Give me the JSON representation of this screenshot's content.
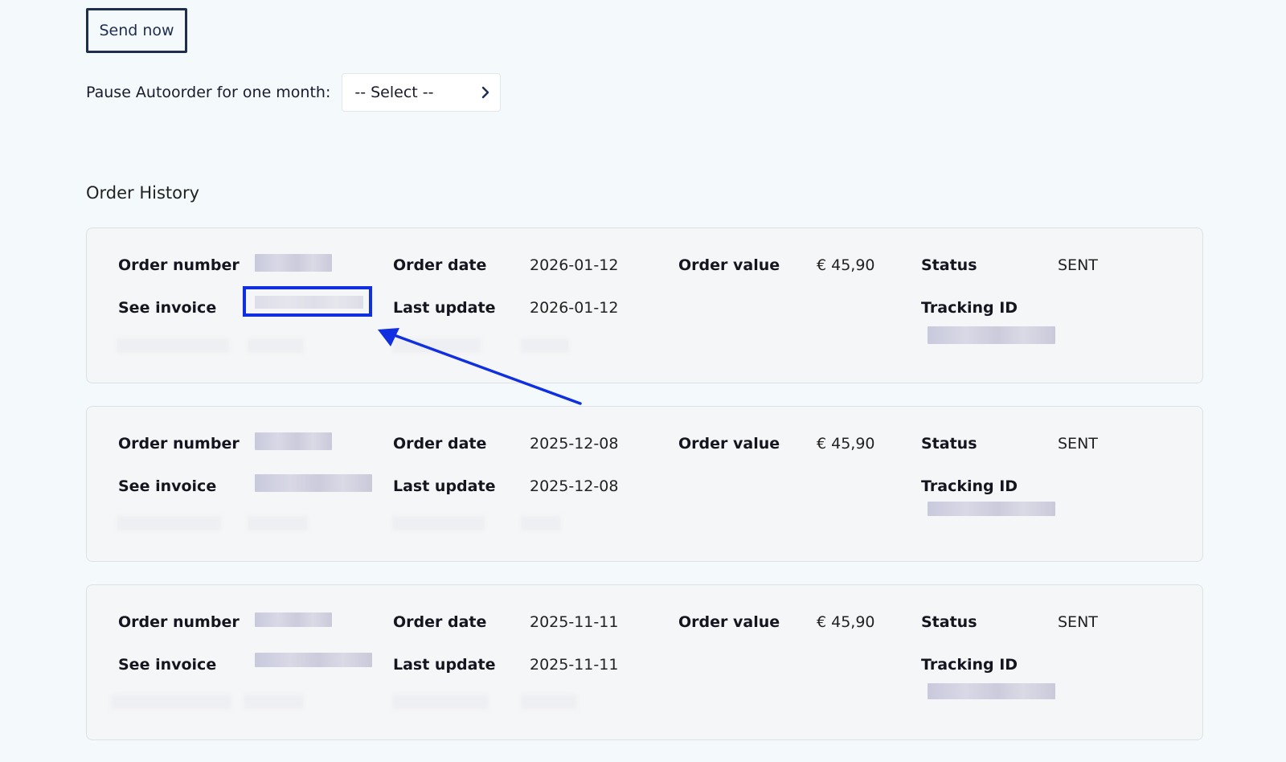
{
  "send_now_label": "Send now",
  "pause": {
    "label": "Pause Autoorder for one month:",
    "select_value": "-- Select --"
  },
  "order_history": {
    "title": "Order History",
    "labels": {
      "order_number": "Order number",
      "see_invoice": "See invoice",
      "order_date": "Order date",
      "last_update": "Last update",
      "order_value": "Order value",
      "status": "Status",
      "tracking_id": "Tracking ID"
    },
    "orders": [
      {
        "order_date": "2026-01-12",
        "last_update": "2026-01-12",
        "order_value": "€ 45,90",
        "status": "SENT"
      },
      {
        "order_date": "2025-12-08",
        "last_update": "2025-12-08",
        "order_value": "€ 45,90",
        "status": "SENT"
      },
      {
        "order_date": "2025-11-11",
        "last_update": "2025-11-11",
        "order_value": "€ 45,90",
        "status": "SENT"
      }
    ]
  },
  "colors": {
    "highlight": "#0f2fe0",
    "button_border": "#1f2d4e",
    "background": "#f4f9fc",
    "card_background": "#f5f6f7"
  }
}
